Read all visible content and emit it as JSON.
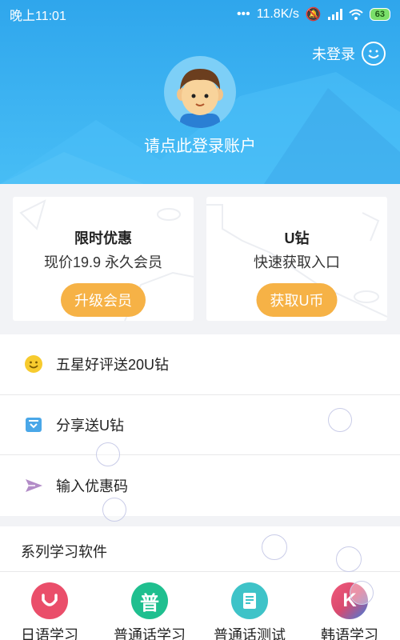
{
  "status_bar": {
    "time": "晚上11:01",
    "network_speed": "11.8K/s",
    "battery": "63"
  },
  "header": {
    "login_status": "未登录",
    "login_prompt": "请点此登录账户"
  },
  "promo_cards": [
    {
      "title": "限时优惠",
      "subtitle": "现价19.9  永久会员",
      "button": "升级会员"
    },
    {
      "title": "U钻",
      "subtitle": "快速获取入口",
      "button": "获取U币"
    }
  ],
  "menu": [
    {
      "label": "五星好评送20U钻",
      "icon": "smiley-icon"
    },
    {
      "label": "分享送U钻",
      "icon": "share-icon"
    },
    {
      "label": "输入优惠码",
      "icon": "send-icon"
    }
  ],
  "series": {
    "title": "系列学习软件",
    "apps": [
      {
        "name": "日语学习",
        "icon_text": "",
        "color": "#ea4e6a"
      },
      {
        "name": "普通话学习",
        "icon_text": "普",
        "color": "#1fbf8f"
      },
      {
        "name": "普通话测试",
        "icon_text": "",
        "color": "#3ec3c8"
      },
      {
        "name": "韩语学习",
        "icon_text": "K",
        "color": "#d64a6f"
      }
    ]
  },
  "colors": {
    "header_blue": "#34aaee",
    "accent_orange": "#f6b246"
  }
}
